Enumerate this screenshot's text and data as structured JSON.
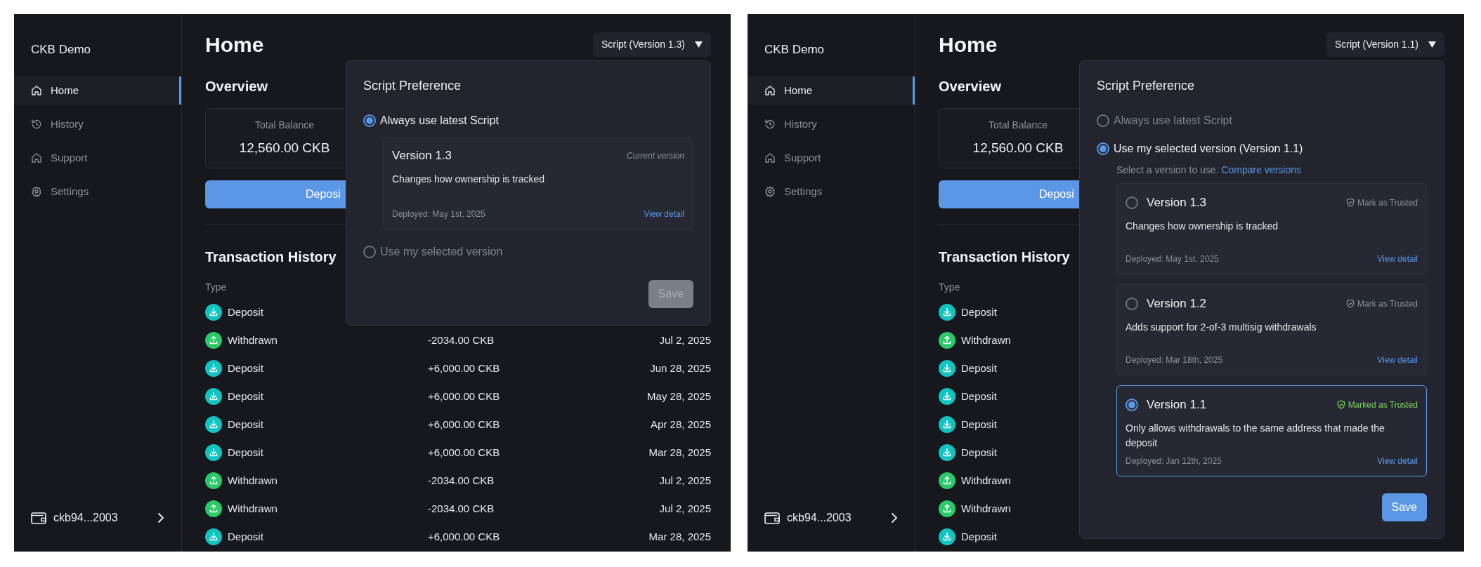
{
  "screens": [
    {
      "app_name": "CKB Demo",
      "nav": [
        {
          "label": "Home",
          "selected": true
        },
        {
          "label": "History",
          "selected": false
        },
        {
          "label": "Support",
          "selected": false
        },
        {
          "label": "Settings",
          "selected": false
        }
      ],
      "wallet": "ckb94...2003",
      "page_title": "Home",
      "script_button": "Script (Version 1.3)",
      "overview": {
        "heading": "Overview",
        "balance_label": "Total Balance",
        "balance": "12,560.00 CKB",
        "deposit_button": "Deposi"
      },
      "history": {
        "heading": "Transaction History",
        "column_1": "Type",
        "rows": [
          {
            "kind": "deposit",
            "type": "Deposit"
          },
          {
            "kind": "withdrawn",
            "type": "Withdrawn",
            "amount": "-2034.00 CKB",
            "date": "Jul 2, 2025"
          },
          {
            "kind": "deposit",
            "type": "Deposit",
            "amount": "+6,000.00 CKB",
            "date": "Jun 28, 2025"
          },
          {
            "kind": "deposit",
            "type": "Deposit",
            "amount": "+6,000.00 CKB",
            "date": "May 28, 2025"
          },
          {
            "kind": "deposit",
            "type": "Deposit",
            "amount": "+6,000.00 CKB",
            "date": "Apr 28, 2025"
          },
          {
            "kind": "deposit",
            "type": "Deposit",
            "amount": "+6,000.00 CKB",
            "date": "Mar 28, 2025"
          },
          {
            "kind": "withdrawn",
            "type": "Withdrawn",
            "amount": "-2034.00 CKB",
            "date": "Jul 2, 2025"
          },
          {
            "kind": "withdrawn",
            "type": "Withdrawn",
            "amount": "-2034.00 CKB",
            "date": "Jul 2, 2025"
          },
          {
            "kind": "deposit",
            "type": "Deposit",
            "amount": "+6,000.00 CKB",
            "date": "Mar 28, 2025"
          }
        ]
      },
      "popover": {
        "title": "Script Preference",
        "options": [
          {
            "label": "Always use latest Script",
            "selected": true,
            "current": {
              "title": "Version 1.3",
              "tag": "Current version",
              "description": "Changes how ownership is tracked",
              "deployed": "Deployed: May 1st, 2025",
              "link": "View detail"
            }
          },
          {
            "label": "Use my selected version",
            "selected": false
          }
        ],
        "save": {
          "label": "Save",
          "disabled": true
        }
      }
    },
    {
      "app_name": "CKB Demo",
      "nav": [
        {
          "label": "Home",
          "selected": true
        },
        {
          "label": "History",
          "selected": false
        },
        {
          "label": "Support",
          "selected": false
        },
        {
          "label": "Settings",
          "selected": false
        }
      ],
      "wallet": "ckb94...2003",
      "page_title": "Home",
      "script_button": "Script (Version 1.1)",
      "overview": {
        "heading": "Overview",
        "balance_label": "Total Balance",
        "balance": "12,560.00 CKB",
        "deposit_button": "Deposi"
      },
      "history": {
        "heading": "Transaction History",
        "column_1": "Type",
        "rows": [
          {
            "kind": "deposit",
            "type": "Deposit"
          },
          {
            "kind": "withdrawn",
            "type": "Withdrawn"
          },
          {
            "kind": "deposit",
            "type": "Deposit"
          },
          {
            "kind": "deposit",
            "type": "Deposit"
          },
          {
            "kind": "deposit",
            "type": "Deposit"
          },
          {
            "kind": "deposit",
            "type": "Deposit"
          },
          {
            "kind": "withdrawn",
            "type": "Withdrawn"
          },
          {
            "kind": "withdrawn",
            "type": "Withdrawn"
          },
          {
            "kind": "deposit",
            "type": "Deposit"
          }
        ]
      },
      "popover": {
        "title": "Script Preference",
        "options": [
          {
            "label": "Always use latest Script",
            "selected": false
          },
          {
            "label": "Use my selected version (Version 1.1)",
            "selected": true,
            "hint": "Select a version to use.",
            "hint_link": "Compare versions",
            "versions": [
              {
                "title": "Version 1.3",
                "selected": false,
                "trusted": false,
                "trust_label": "Mark as Trusted",
                "description": "Changes how ownership is tracked",
                "deployed": "Deployed: May 1st, 2025",
                "link": "View detail"
              },
              {
                "title": "Version 1.2",
                "selected": false,
                "trusted": false,
                "trust_label": "Mark as Trusted",
                "description": "Adds support for 2-of-3 multisig withdrawals",
                "deployed": "Deployed: Mar 18th, 2025",
                "link": "View detail"
              },
              {
                "title": "Version 1.1",
                "selected": true,
                "trusted": true,
                "trust_label": "Marked as Trusted",
                "description": "Only allows withdrawals to the same address that made the deposit",
                "deployed": "Deployed: Jan 12th, 2025",
                "link": "View detail"
              }
            ]
          }
        ],
        "save": {
          "label": "Save",
          "disabled": false
        }
      }
    }
  ]
}
